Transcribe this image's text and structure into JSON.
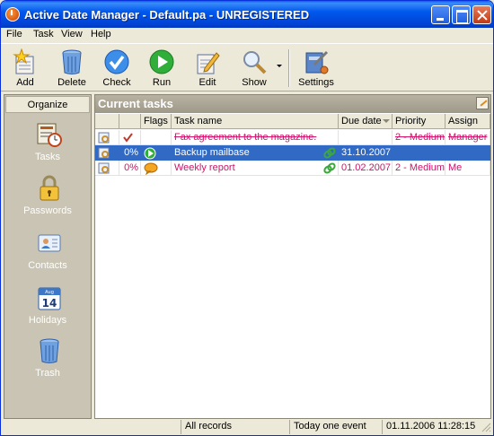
{
  "window": {
    "title": "Active Date Manager - Default.pa - UNREGISTERED"
  },
  "menu": [
    "File",
    "Task",
    "View",
    "Help"
  ],
  "toolbar": {
    "add": "Add",
    "delete": "Delete",
    "check": "Check",
    "run": "Run",
    "edit": "Edit",
    "show": "Show",
    "settings": "Settings"
  },
  "sidebar": {
    "header": "Organize",
    "items": [
      {
        "label": "Tasks",
        "icon": "tasks-icon"
      },
      {
        "label": "Passwords",
        "icon": "lock-icon"
      },
      {
        "label": "Contacts",
        "icon": "contacts-card-icon"
      },
      {
        "label": "Holidays",
        "icon": "calendar-icon"
      },
      {
        "label": "Trash",
        "icon": "trash-can-icon"
      }
    ]
  },
  "main": {
    "title": "Current tasks",
    "columns": {
      "flags": "Flags",
      "task": "Task name",
      "due": "Due date",
      "priority": "Priority",
      "assign": "Assign"
    },
    "rows": [
      {
        "pct": "",
        "task": "Fax agreement to the magazine.",
        "due": "",
        "priority": "2 - Medium",
        "assign": "Manager",
        "state": "done"
      },
      {
        "pct": "0%",
        "task": "Backup mailbase",
        "due": "31.10.2007",
        "priority": "",
        "assign": "",
        "state": "selected"
      },
      {
        "pct": "0%",
        "task": "Weekly report",
        "due": "01.02.2007",
        "priority": "2 - Medium",
        "assign": "Me",
        "state": "overdue"
      }
    ]
  },
  "status": {
    "records": "All records",
    "today": "Today one event",
    "datetime": "01.11.2006 11:28:15"
  },
  "colors": {
    "accent": "#316ac5",
    "overdue": "#d0116b",
    "titlebar": "#0058ee"
  }
}
